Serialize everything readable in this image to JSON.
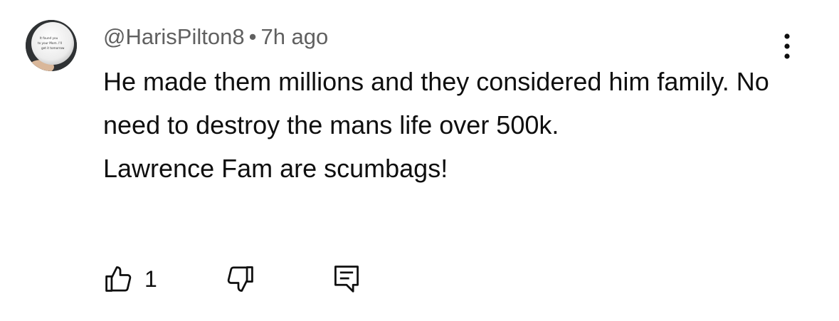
{
  "comment": {
    "author": "@HarisPilton8",
    "separator": "•",
    "time": "7h ago",
    "lines": [
      "He made them millions and they considered him family. No need to destroy the mans life over 500k.",
      "Lawrence Fam are scumbags!"
    ],
    "like_count": "1"
  },
  "avatar": {
    "description_icon": "golf-ball-avatar",
    "ball_text": [
      "It found you",
      "to your Mom. I'll",
      "get it tomorrow"
    ]
  },
  "icons": {
    "more": "more-vert-icon",
    "like": "thumb-up-icon",
    "dislike": "thumb-down-icon",
    "reply": "reply-comment-icon"
  },
  "colors": {
    "text_primary": "#0f0f0f",
    "text_secondary": "#606060",
    "background": "#ffffff"
  }
}
